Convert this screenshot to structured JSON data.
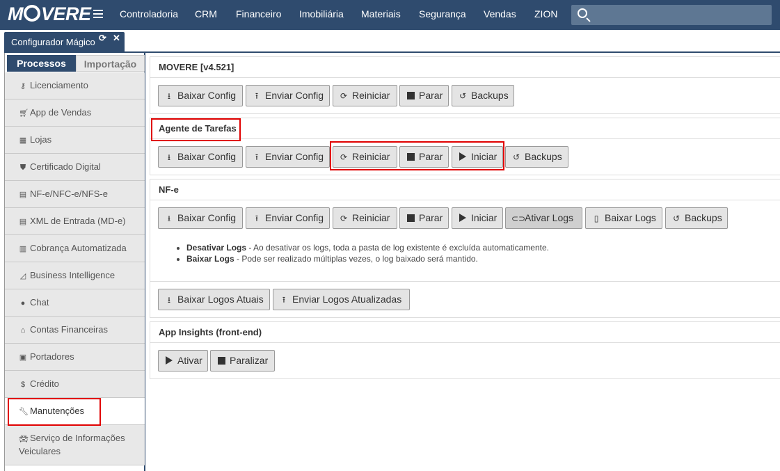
{
  "app": {
    "logo": "MOVERE",
    "nav": [
      "Controladoria",
      "CRM",
      "Financeiro",
      "Imobiliária",
      "Materiais",
      "Segurança",
      "Vendas",
      "ZION"
    ],
    "search_placeholder": ""
  },
  "tab": {
    "title": "Configurador Mágico"
  },
  "sidebar": {
    "tabs": [
      "Processos",
      "Importação"
    ],
    "items": [
      {
        "label": "Licenciamento",
        "icon": "key-icon"
      },
      {
        "label": "App de Vendas",
        "icon": "cart-icon"
      },
      {
        "label": "Lojas",
        "icon": "building-icon"
      },
      {
        "label": "Certificado Digital",
        "icon": "shield-icon"
      },
      {
        "label": "NF-e/NFC-e/NFS-e",
        "icon": "file-invoice-icon"
      },
      {
        "label": "XML de Entrada (MD-e)",
        "icon": "file-text-icon"
      },
      {
        "label": "Cobrança Automatizada",
        "icon": "barcode-icon"
      },
      {
        "label": "Business Intelligence",
        "icon": "area-chart-icon"
      },
      {
        "label": "Chat",
        "icon": "chat-icon"
      },
      {
        "label": "Contas Financeiras",
        "icon": "bank-icon"
      },
      {
        "label": "Portadores",
        "icon": "money-icon"
      },
      {
        "label": "Crédito",
        "icon": "dollar-icon"
      },
      {
        "label": "Manutenções",
        "icon": "wrench-icon"
      },
      {
        "label": "Serviço de Informações Veiculares",
        "icon": "car-icon"
      }
    ]
  },
  "sections": {
    "movere": {
      "title": "MOVERE [v4.521]",
      "buttons": [
        "Baixar Config",
        "Enviar Config",
        "Reiniciar",
        "Parar",
        "Backups"
      ]
    },
    "agente": {
      "title": "Agente de Tarefas",
      "buttons": [
        "Baixar Config",
        "Enviar Config",
        "Reiniciar",
        "Parar",
        "Iniciar",
        "Backups"
      ]
    },
    "nfe": {
      "title": "NF-e",
      "buttons": [
        "Baixar Config",
        "Enviar Config",
        "Reiniciar",
        "Parar",
        "Iniciar",
        "Ativar Logs",
        "Baixar Logs",
        "Backups"
      ],
      "notes": [
        {
          "term": "Desativar Logs",
          "text": " - Ao desativar os logs, toda a pasta de log existente é excluída automaticamente."
        },
        {
          "term": "Baixar Logs",
          "text": " - Pode ser realizado múltiplas vezes, o log baixado será mantido."
        }
      ],
      "logo_buttons": [
        "Baixar Logos Atuais",
        "Enviar Logos Atualizadas"
      ]
    },
    "insights": {
      "title": "App Insights (front-end)",
      "buttons": [
        "Ativar",
        "Paralizar"
      ]
    }
  },
  "colors": {
    "nav_bg": "#2f4b6e",
    "highlight": "#e00000"
  }
}
